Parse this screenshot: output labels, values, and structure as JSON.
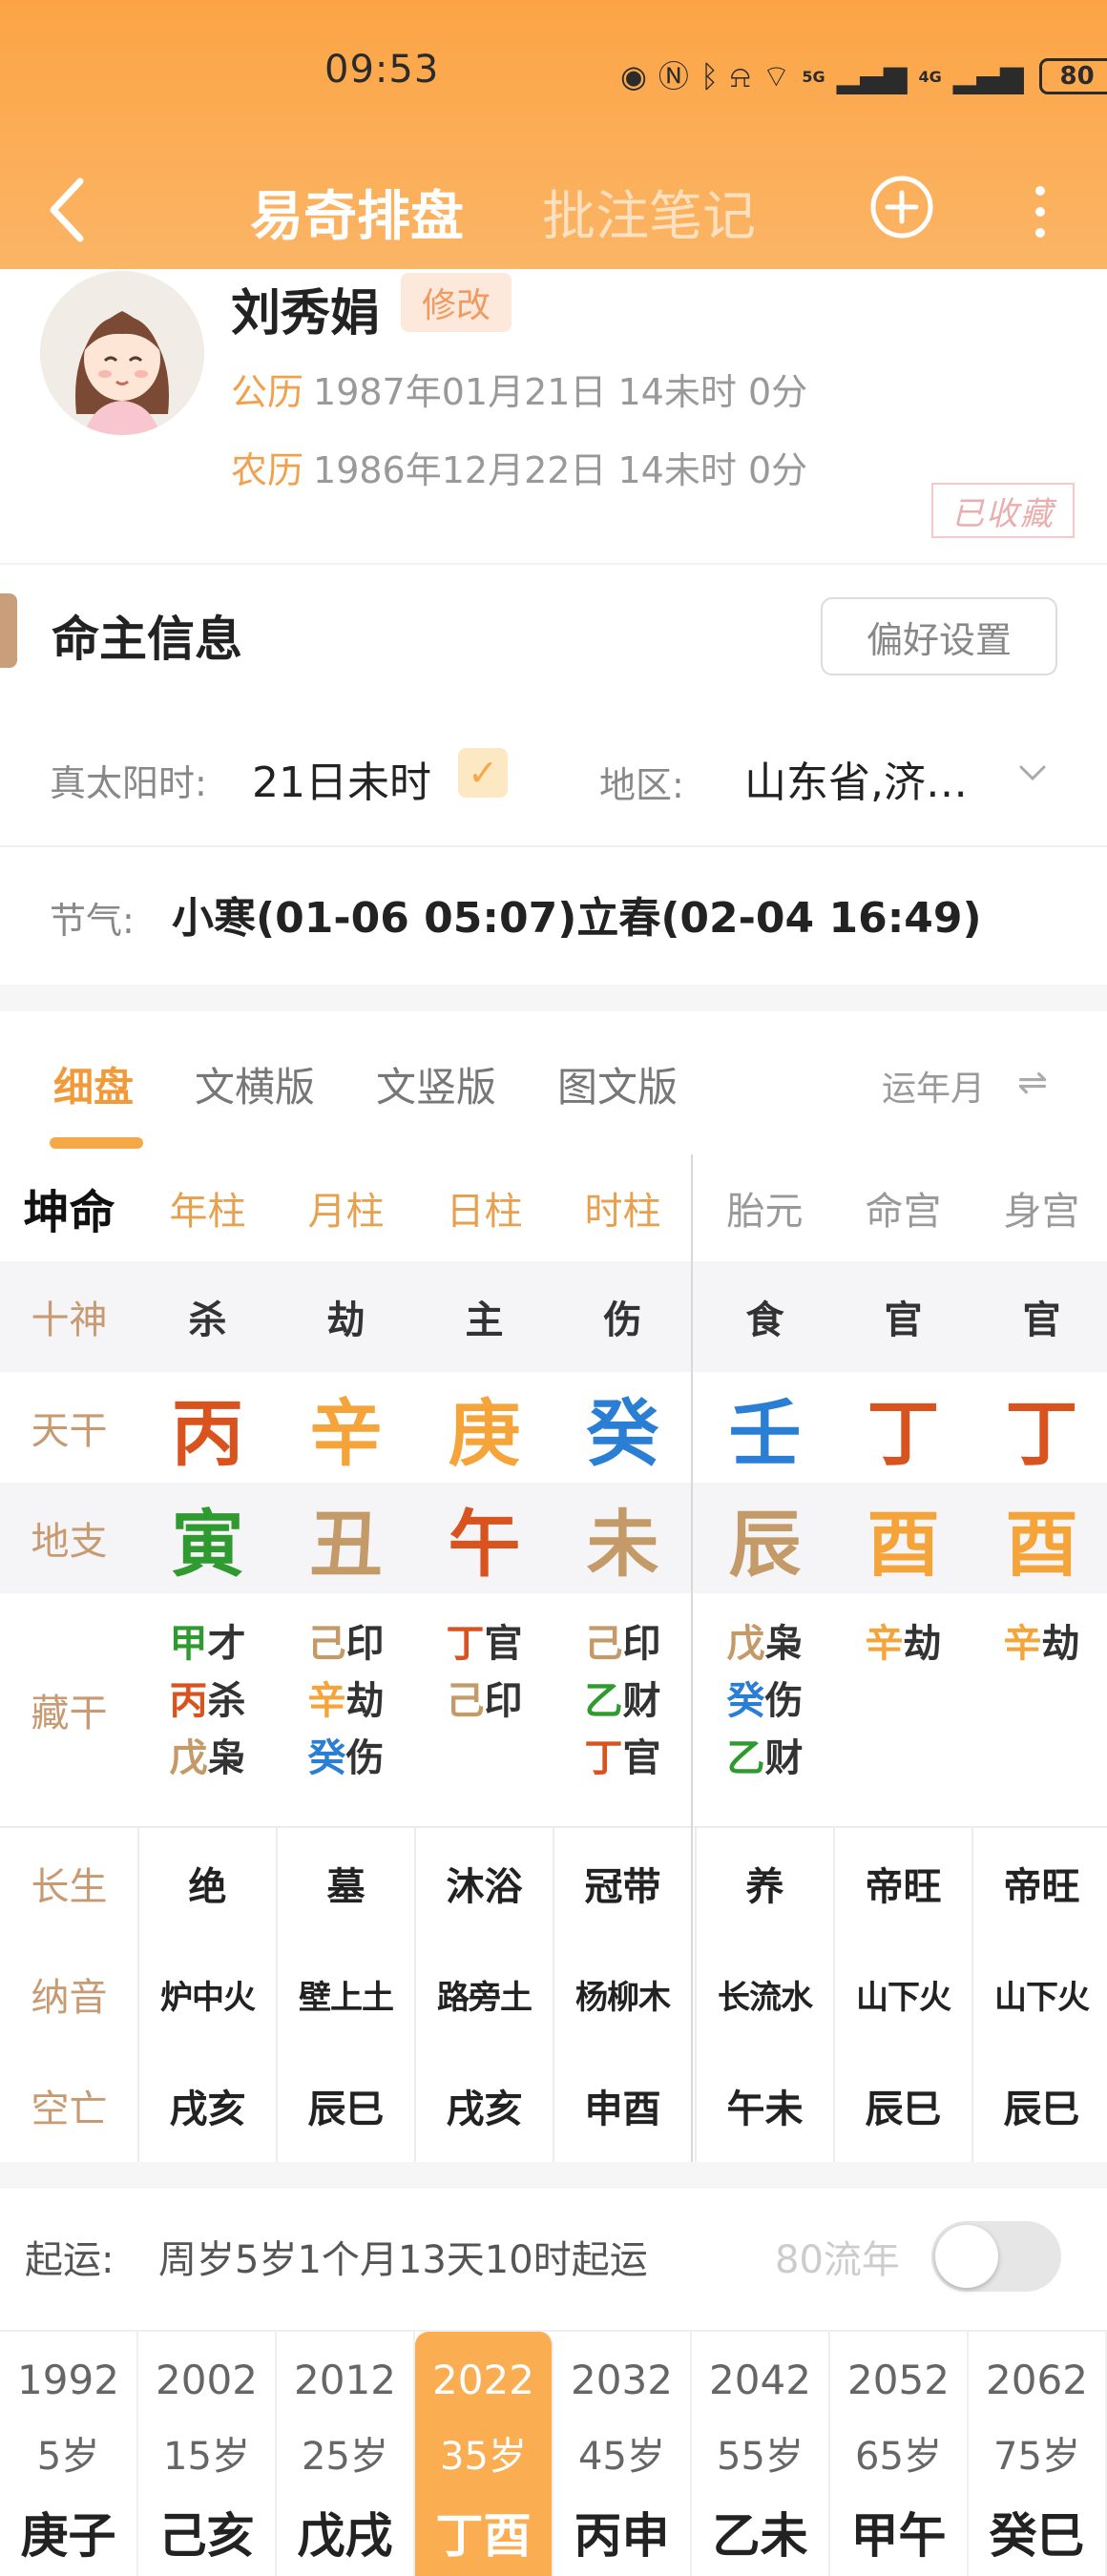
{
  "status_bar": {
    "time": "09:53",
    "battery": "80",
    "sig1": "5G",
    "sig2": "4G"
  },
  "nav": {
    "tab_active": "易奇排盘",
    "tab_inactive": "批注笔记"
  },
  "profile": {
    "name": "刘秀娟",
    "edit_label": "修改",
    "solar_label": "公历",
    "solar_value": "1987年01月21日 14未时 0分",
    "lunar_label": "农历",
    "lunar_value": "1986年12月22日 14未时 0分",
    "collected_stamp": "已收藏"
  },
  "info": {
    "title": "命主信息",
    "pref_button": "偏好设置",
    "sun_time_label": "真太阳时:",
    "sun_time_value": "21日未时",
    "region_label": "地区:",
    "region_value": "山东省,济…",
    "term_label": "节气:",
    "term_value": "小寒(01-06 05:07)立春(02-04 16:49)"
  },
  "view_tabs": {
    "tabs": [
      "细盘",
      "文横版",
      "文竖版",
      "图文版"
    ],
    "active_index": 0,
    "yrmon_label": "运年月",
    "swap_icon": "⇌"
  },
  "table": {
    "gender": "坤命",
    "headers": [
      "年柱",
      "月柱",
      "日柱",
      "时柱",
      "胎元",
      "命宫",
      "身宫"
    ],
    "labels": {
      "shishen": "十神",
      "tiangan": "天干",
      "dizhi": "地支",
      "canggan": "藏干",
      "changsheng": "长生",
      "nayin": "纳音",
      "kongwang": "空亡"
    },
    "shishen": [
      "杀",
      "劫",
      "主",
      "伤",
      "食",
      "官",
      "官"
    ],
    "tiangan": [
      {
        "char": "丙",
        "color": "#d9531e"
      },
      {
        "char": "辛",
        "color": "#f5a43a"
      },
      {
        "char": "庚",
        "color": "#f5a43a"
      },
      {
        "char": "癸",
        "color": "#2a7fd4"
      },
      {
        "char": "壬",
        "color": "#2a7fd4"
      },
      {
        "char": "丁",
        "color": "#d9531e"
      },
      {
        "char": "丁",
        "color": "#d9531e"
      }
    ],
    "dizhi": [
      {
        "char": "寅",
        "color": "#2f9a2f"
      },
      {
        "char": "丑",
        "color": "#c39a68"
      },
      {
        "char": "午",
        "color": "#d9531e"
      },
      {
        "char": "未",
        "color": "#c39a68"
      },
      {
        "char": "辰",
        "color": "#c39a68"
      },
      {
        "char": "酉",
        "color": "#f5a43a"
      },
      {
        "char": "酉",
        "color": "#f5a43a"
      }
    ],
    "canggan": [
      [
        {
          "gan": "甲",
          "color": "#2f9a2f",
          "god": "才"
        },
        {
          "gan": "丙",
          "color": "#d9531e",
          "god": "杀"
        },
        {
          "gan": "戊",
          "color": "#c39a68",
          "god": "枭"
        }
      ],
      [
        {
          "gan": "己",
          "color": "#c39a68",
          "god": "印"
        },
        {
          "gan": "辛",
          "color": "#f5a43a",
          "god": "劫"
        },
        {
          "gan": "癸",
          "color": "#2a7fd4",
          "god": "伤"
        }
      ],
      [
        {
          "gan": "丁",
          "color": "#d9531e",
          "god": "官"
        },
        {
          "gan": "己",
          "color": "#c39a68",
          "god": "印"
        }
      ],
      [
        {
          "gan": "己",
          "color": "#c39a68",
          "god": "印"
        },
        {
          "gan": "乙",
          "color": "#2f9a2f",
          "god": "财"
        },
        {
          "gan": "丁",
          "color": "#d9531e",
          "god": "官"
        }
      ],
      [
        {
          "gan": "戊",
          "color": "#c39a68",
          "god": "枭"
        },
        {
          "gan": "癸",
          "color": "#2a7fd4",
          "god": "伤"
        },
        {
          "gan": "乙",
          "color": "#2f9a2f",
          "god": "财"
        }
      ],
      [
        {
          "gan": "辛",
          "color": "#f5a43a",
          "god": "劫"
        }
      ],
      [
        {
          "gan": "辛",
          "color": "#f5a43a",
          "god": "劫"
        }
      ]
    ],
    "changsheng": [
      "绝",
      "墓",
      "沐浴",
      "冠带",
      "养",
      "帝旺",
      "帝旺"
    ],
    "nayin": [
      "炉中火",
      "壁上土",
      "路旁土",
      "杨柳木",
      "长流水",
      "山下火",
      "山下火"
    ],
    "kongwang": [
      "戌亥",
      "辰巳",
      "戌亥",
      "申酉",
      "午未",
      "辰巳",
      "辰巳"
    ]
  },
  "luck": {
    "label": "起运:",
    "text": "周岁5岁1个月13天10时起运",
    "flow_label": "80流年",
    "toggle_on": false
  },
  "dayun": [
    {
      "year": "1992",
      "age": "5岁",
      "gz": "庚子"
    },
    {
      "year": "2002",
      "age": "15岁",
      "gz": "己亥"
    },
    {
      "year": "2012",
      "age": "25岁",
      "gz": "戊戌"
    },
    {
      "year": "2022",
      "age": "35岁",
      "gz": "丁酉",
      "active": true
    },
    {
      "year": "2032",
      "age": "45岁",
      "gz": "丙申"
    },
    {
      "year": "2042",
      "age": "55岁",
      "gz": "乙未"
    },
    {
      "year": "2052",
      "age": "65岁",
      "gz": "甲午"
    },
    {
      "year": "2062",
      "age": "75岁",
      "gz": "癸巳"
    }
  ],
  "colors": {
    "accent": "#f6a847",
    "header_top": "#fca445",
    "label_brown": "#c89a72"
  }
}
